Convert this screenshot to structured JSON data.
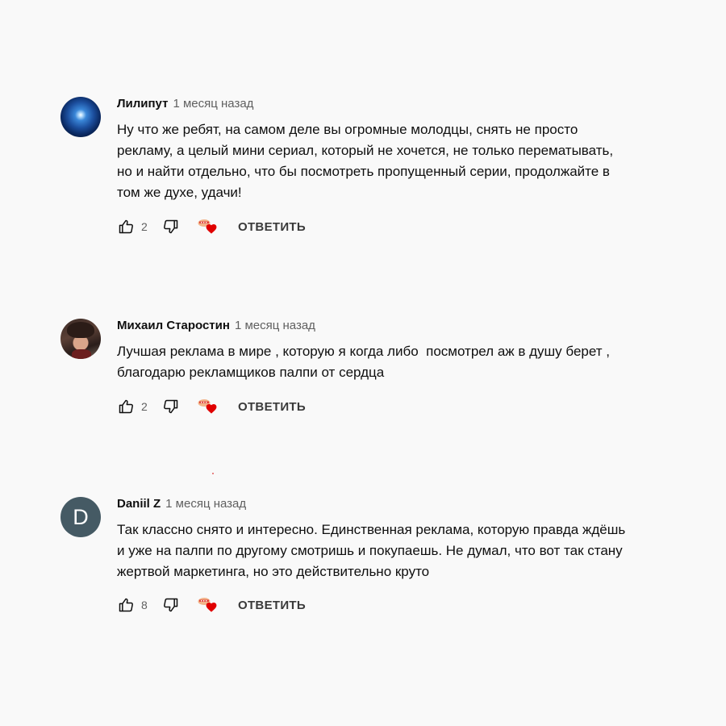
{
  "comments": [
    {
      "author": "Лилипут",
      "time": "1 месяц назад",
      "text": "Ну что же ребят, на самом деле вы огромные молодцы, снять не просто\nрекламу, а целый мини сериал, который не хочется, не только перематывать,\nно и найти отдельно, что бы посмотреть пропущенный серии, продолжайте в\nтом же духе, удачи!",
      "likes": "2",
      "reply_label": "ОТВЕТИТЬ",
      "avatar": "space-avatar"
    },
    {
      "author": "Михаил Старостин",
      "time": "1 месяц назад",
      "text": "Лучшая реклама в мире , которую я когда либо  посмотрел аж в душу берет ,\nблагодарю рекламщиков палпи от сердца",
      "likes": "2",
      "reply_label": "ОТВЕТИТЬ",
      "avatar": "anime-avatar"
    },
    {
      "author": "Daniil Z",
      "time": "1 месяц назад",
      "text": "Так классно снято и интересно. Единственная реклама, которую правда ждёшь\nи уже на палпи по другому смотришь и покупаешь. Не думал, что вот так стану\nжертвой маркетинга, но это действительно круто",
      "likes": "8",
      "reply_label": "ОТВЕТИТЬ",
      "avatar_letter": "D"
    }
  ],
  "icons": {
    "like": "thumbs-up-icon",
    "dislike": "thumbs-down-icon",
    "creator_heart": "creator-heart-icon"
  },
  "colors": {
    "background": "#f9f9f9",
    "heart": "#e00000",
    "secondary_text": "#606060",
    "letter_avatar": "#455a64"
  }
}
